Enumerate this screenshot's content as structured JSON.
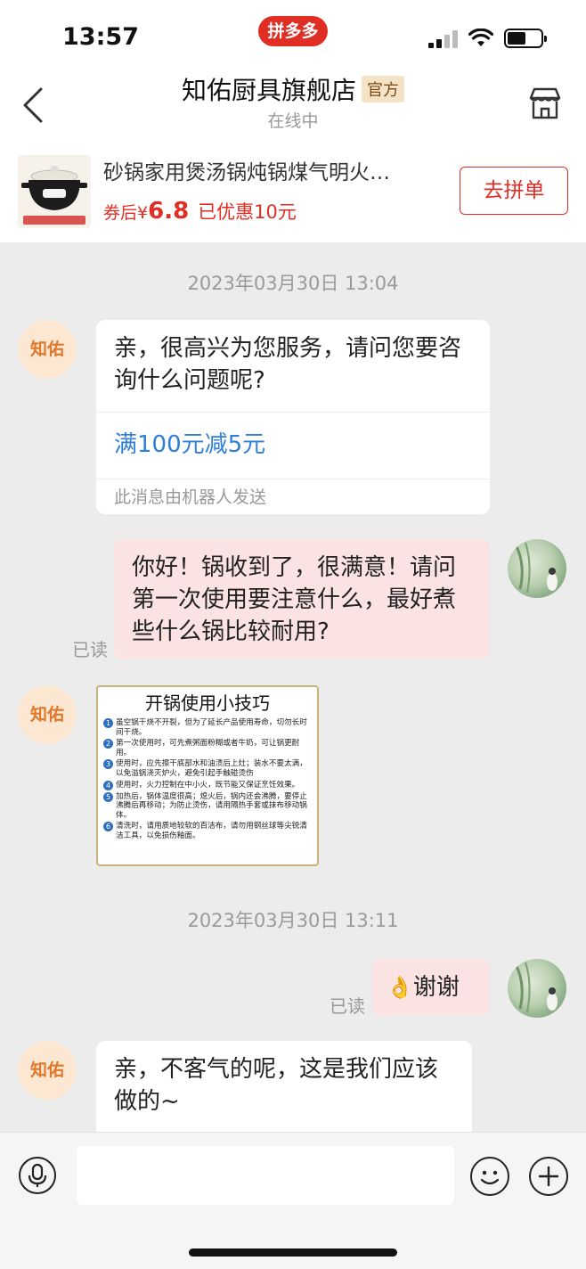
{
  "status_bar": {
    "time": "13:57",
    "app_badge": "拼多多"
  },
  "header": {
    "store_name": "知佑厨具旗舰店",
    "official_tag": "官方",
    "status": "在线中"
  },
  "product": {
    "title": "砂锅家用煲汤锅炖锅煤气明火…",
    "price_prefix": "券后",
    "currency": "¥",
    "price": "6.8",
    "discount": "已优惠10元",
    "button": "去拼单"
  },
  "shop_avatar_text": "知佑",
  "messages": {
    "ts1": "2023年03月30日 13:04",
    "greeting": "亲，很高兴为您服务，请问您要咨询什么问题呢?",
    "promo_link": "满100元减5元",
    "robot_note": "此消息由机器人发送",
    "user_question": "你好！锅收到了，很满意！请问第一次使用要注意什么，最好煮些什么锅比较耐用?",
    "read1": "已读",
    "tips_title": "开锅使用小技巧",
    "tips": [
      "虽空锅干烧不开裂，但为了延长产品使用寿命，切勿长时间干烧。",
      "第一次使用时，可先煮粥面粉糊或者牛奶，可让锅更耐用。",
      "使用时，应先擦干底部水和油渍后上灶；装水不要太满，以免溢锅浇灭炉火，避免引起手触碰烫伤",
      "使用时，火力控制在中小火，既节能又保证烹饪效果。",
      "加热后，锅体温度很高；熄火后，锅内还会沸腾，要停止沸腾后再移动；为防止烫伤，请用隔热手套或抹布移动锅体。",
      "清洗时，请用质地较软的百洁布，请勿用钢丝球等尖锐清洁工具，以免损伤釉面。"
    ],
    "tip_numbers": [
      "1",
      "2",
      "3",
      "4",
      "5",
      "6"
    ],
    "ts2": "2023年03月30日 13:11",
    "thanks_emoji": "👌",
    "thanks": "谢谢",
    "read2": "已读",
    "reply": "亲，不客气的呢，这是我们应该做的~"
  },
  "colors": {
    "brand_red": "#e02e24",
    "link_blue": "#2f7ed8",
    "user_bubble": "#fbe3e3"
  },
  "icons": [
    "back-arrow-icon",
    "store-icon",
    "microphone-icon",
    "emoji-icon",
    "plus-icon"
  ]
}
